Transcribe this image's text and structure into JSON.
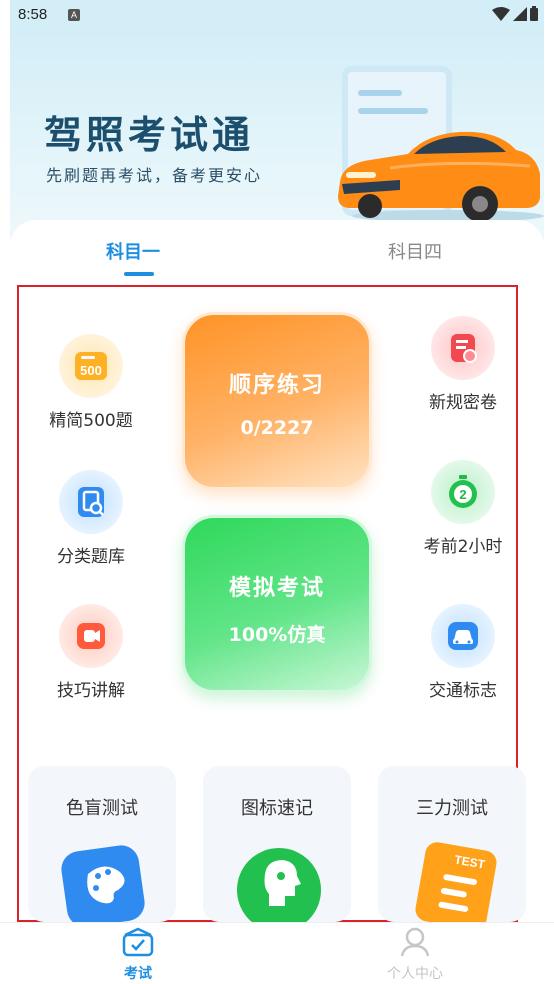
{
  "status_bar": {
    "time": "8:58",
    "notification_badge": "A"
  },
  "hero": {
    "title": "驾照考试通",
    "subtitle": "先刷题再考试，备考更安心"
  },
  "subject_tabs": [
    {
      "label": "科目一",
      "active": true
    },
    {
      "label": "科目四",
      "active": false
    }
  ],
  "left_items": [
    {
      "label": "精简500题",
      "icon": "500-questions-icon",
      "badge": "500"
    },
    {
      "label": "分类题库",
      "icon": "category-bank-icon"
    },
    {
      "label": "技巧讲解",
      "icon": "video-tips-icon"
    }
  ],
  "right_items": [
    {
      "label": "新规密卷",
      "icon": "secret-paper-icon"
    },
    {
      "label": "考前2小时",
      "icon": "timer-icon",
      "badge": "2"
    },
    {
      "label": "交通标志",
      "icon": "traffic-sign-car-icon"
    }
  ],
  "sequential_practice": {
    "title": "顺序练习",
    "progress": "0/2227"
  },
  "mock_exam": {
    "title": "模拟考试",
    "subtitle": "100%仿真"
  },
  "bottom_cards": [
    {
      "label": "色盲测试",
      "icon": "palette-icon"
    },
    {
      "label": "图标速记",
      "icon": "head-profile-icon"
    },
    {
      "label": "三力测试",
      "icon": "test-notebook-icon",
      "badge": "TEST"
    }
  ],
  "tab_bar": [
    {
      "label": "考试",
      "icon": "exam-check-icon",
      "active": true
    },
    {
      "label": "个人中心",
      "icon": "user-icon",
      "active": false
    }
  ],
  "colors": {
    "accent": "#1e8fe0",
    "orange": "#ff9326",
    "green": "#2fd85a",
    "highlight_border": "#d8232a"
  }
}
